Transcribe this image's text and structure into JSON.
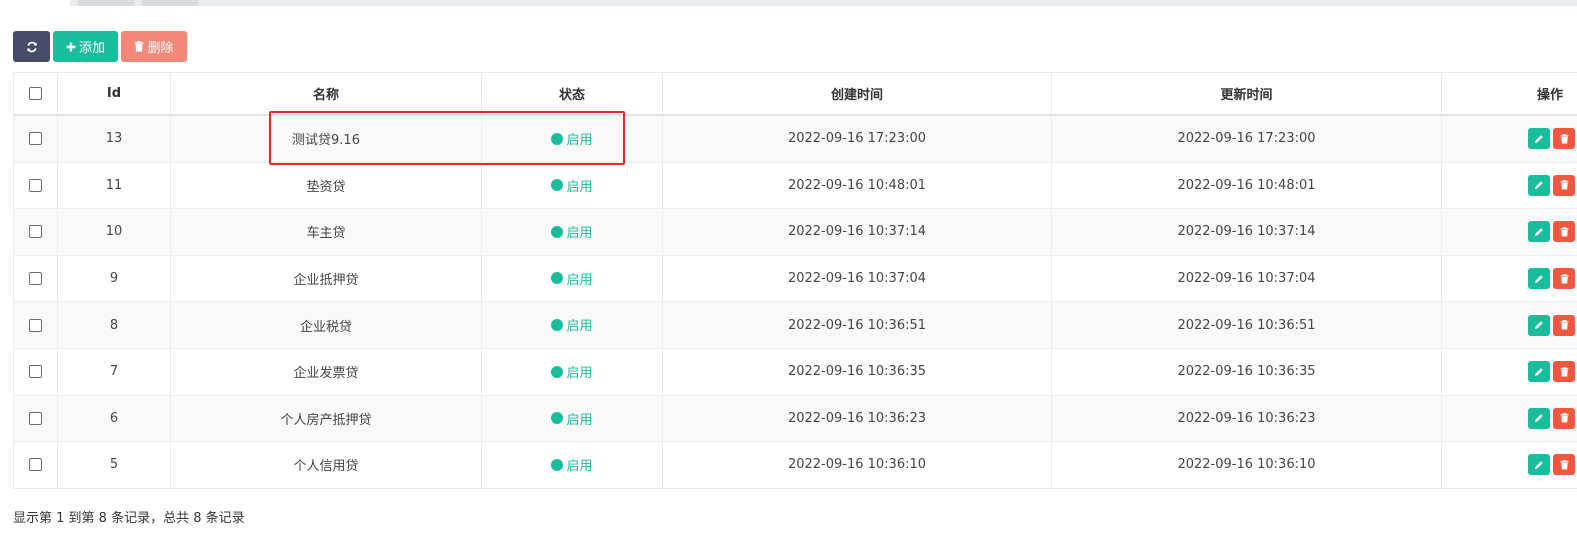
{
  "toolbar": {
    "refresh_icon": "refresh-icon",
    "add_label": "添加",
    "delete_label": "删除"
  },
  "table": {
    "columns": [
      "Id",
      "名称",
      "状态",
      "创建时间",
      "更新时间",
      "操作"
    ],
    "rows": [
      {
        "id": "13",
        "name": "测试贷9.16",
        "status": "启用",
        "created": "2022-09-16 17:23:00",
        "updated": "2022-09-16 17:23:00"
      },
      {
        "id": "11",
        "name": "垫资贷",
        "status": "启用",
        "created": "2022-09-16 10:48:01",
        "updated": "2022-09-16 10:48:01"
      },
      {
        "id": "10",
        "name": "车主贷",
        "status": "启用",
        "created": "2022-09-16 10:37:14",
        "updated": "2022-09-16 10:37:14"
      },
      {
        "id": "9",
        "name": "企业抵押贷",
        "status": "启用",
        "created": "2022-09-16 10:37:04",
        "updated": "2022-09-16 10:37:04"
      },
      {
        "id": "8",
        "name": "企业税贷",
        "status": "启用",
        "created": "2022-09-16 10:36:51",
        "updated": "2022-09-16 10:36:51"
      },
      {
        "id": "7",
        "name": "企业发票贷",
        "status": "启用",
        "created": "2022-09-16 10:36:35",
        "updated": "2022-09-16 10:36:35"
      },
      {
        "id": "6",
        "name": "个人房产抵押贷",
        "status": "启用",
        "created": "2022-09-16 10:36:23",
        "updated": "2022-09-16 10:36:23"
      },
      {
        "id": "5",
        "name": "个人信用贷",
        "status": "启用",
        "created": "2022-09-16 10:36:10",
        "updated": "2022-09-16 10:36:10"
      }
    ]
  },
  "footer": {
    "summary": "显示第 1 到第 8 条记录，总共 8 条记录"
  },
  "colors": {
    "accent": "#1bbc9b",
    "danger": "#f0573f",
    "refresh": "#444c69",
    "highlight": "#e32a2a"
  }
}
